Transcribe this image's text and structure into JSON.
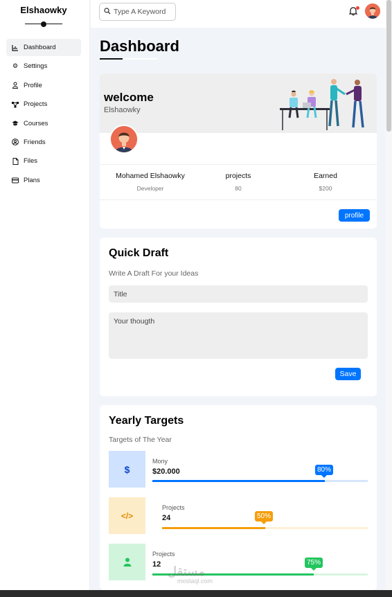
{
  "brand": "Elshaowky",
  "sidebar": {
    "items": [
      {
        "label": "Dashboard",
        "icon": "chart-icon",
        "active": true
      },
      {
        "label": "Settings",
        "icon": "gear-icon"
      },
      {
        "label": "Profile",
        "icon": "user-icon"
      },
      {
        "label": "Projects",
        "icon": "diagram-icon"
      },
      {
        "label": "Courses",
        "icon": "graduation-cap-icon"
      },
      {
        "label": "Friends",
        "icon": "user-circle-icon"
      },
      {
        "label": "Files",
        "icon": "file-icon"
      },
      {
        "label": "Plans",
        "icon": "credit-card-icon"
      }
    ]
  },
  "header": {
    "search_placeholder": "Type A Keyword",
    "notification_color": "#f44336"
  },
  "page_title": "Dashboard",
  "welcome": {
    "title": "welcome",
    "name": "Elshaowky",
    "stats": [
      {
        "label": "Mohamed Elshaowky",
        "value": "Developer"
      },
      {
        "label": "projects",
        "value": "80"
      },
      {
        "label": "Earned",
        "value": "$200"
      }
    ],
    "profile_button": "profile"
  },
  "draft": {
    "title": "Quick Draft",
    "subtitle": "Write A Draft For your Ideas",
    "title_placeholder": "Title",
    "body_placeholder": "Your thougth",
    "save_button": "Save"
  },
  "targets": {
    "title": "Yearly Targets",
    "subtitle": "Targets of The Year",
    "items": [
      {
        "label": "Mony",
        "value": "$20.000",
        "percent": 80,
        "badge": "80%",
        "color": "#0075ff",
        "track": "#d6e6fb",
        "bg": "#cfe2ff",
        "icon": "dollar-icon",
        "glyph": "$"
      },
      {
        "label": "Projects",
        "value": "24",
        "percent": 50,
        "badge": "50%",
        "color": "#f59e0b",
        "track": "#fdf0d5",
        "bg": "#fdecc8",
        "icon": "code-icon",
        "glyph": "</>"
      },
      {
        "label": "Projects",
        "value": "12",
        "percent": 75,
        "badge": "75%",
        "color": "#22c55e",
        "track": "#d8f5e1",
        "bg": "#d1f4dd",
        "icon": "user-icon",
        "glyph": "👤"
      }
    ]
  },
  "watermark": {
    "arabic": "مستقل",
    "latin": "mostaql.com"
  }
}
